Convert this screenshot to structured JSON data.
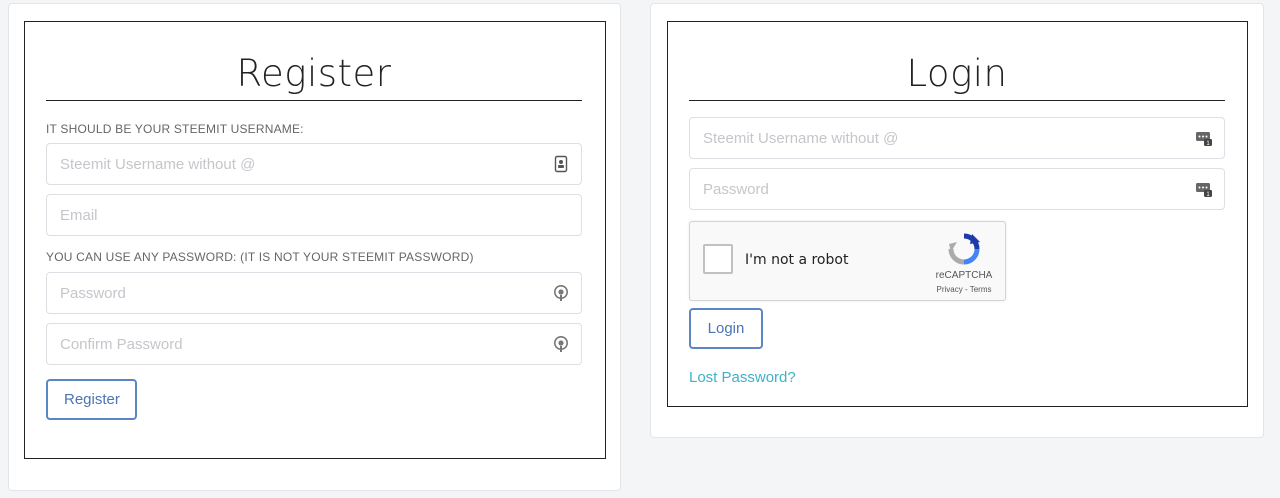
{
  "register": {
    "title": "Register",
    "username_hint": "IT SHOULD BE YOUR STEEMIT USERNAME:",
    "username_placeholder": "Steemit Username without @",
    "email_placeholder": "Email",
    "password_hint": "YOU CAN USE ANY PASSWORD: (IT IS NOT YOUR STEEMIT PASSWORD)",
    "password_placeholder": "Password",
    "confirm_placeholder": "Confirm Password",
    "button_label": "Register",
    "icons": [
      "contact-card-icon",
      "key-icon",
      "key-icon"
    ]
  },
  "login": {
    "title": "Login",
    "username_placeholder": "Steemit Username without @",
    "password_placeholder": "Password",
    "icons": [
      "password-manager-icon",
      "password-manager-icon"
    ],
    "captcha": {
      "label": "I'm not a robot",
      "brand": "reCAPTCHA",
      "terms": "Privacy - Terms",
      "checked": false
    },
    "button_label": "Login",
    "lost_password_label": "Lost Password?"
  },
  "colors": {
    "button_border": "#5b86c4",
    "button_text": "#4a74b3",
    "link": "#3fb1c8",
    "page_background": "#f4f5f7"
  }
}
